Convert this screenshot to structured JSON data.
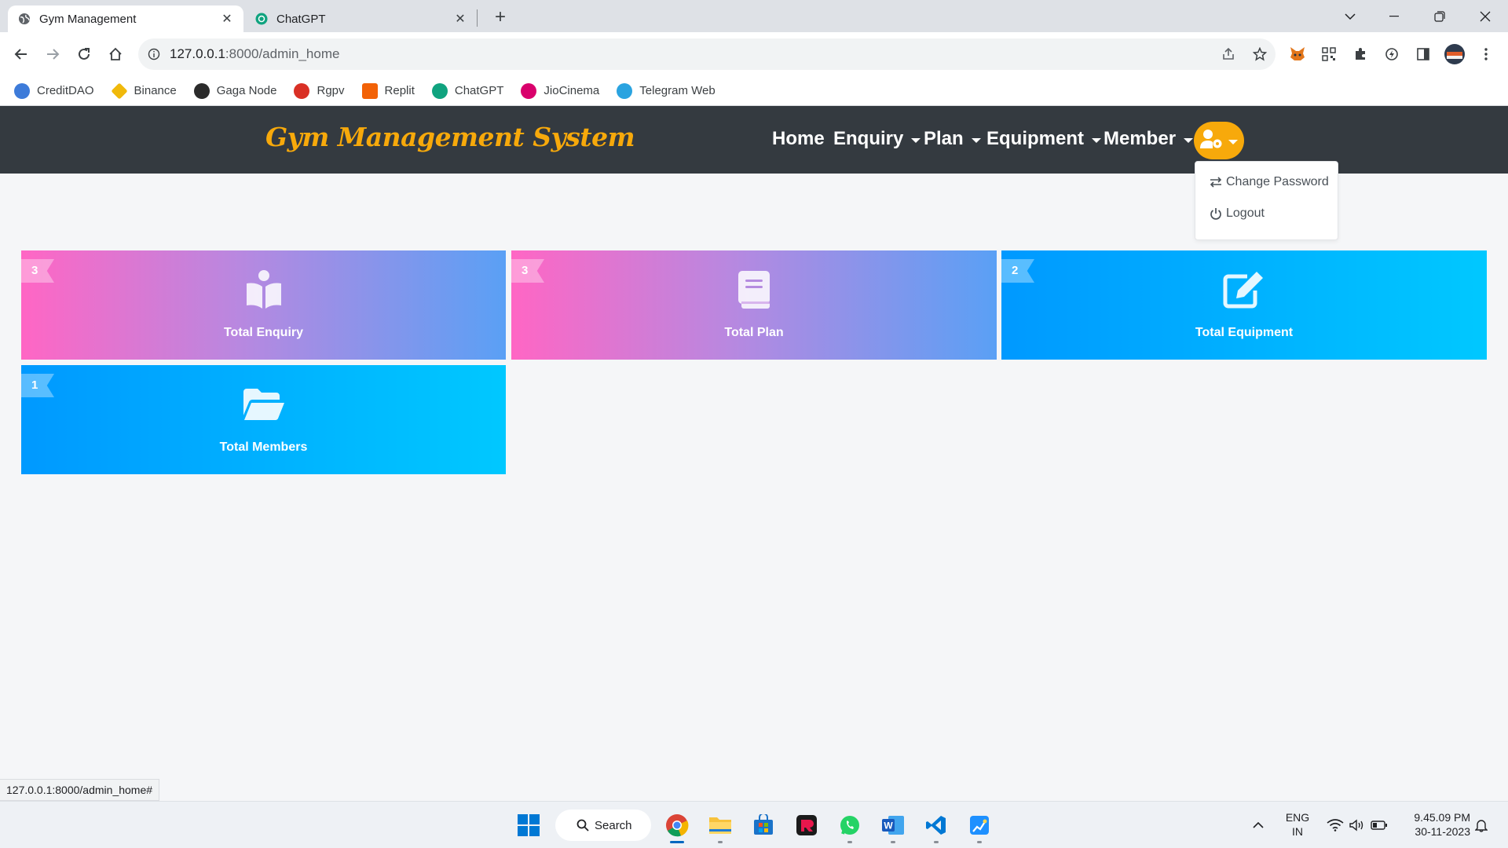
{
  "browser": {
    "tabs": [
      {
        "title": "Gym Management",
        "active": true,
        "icon": "globe-icon"
      },
      {
        "title": "ChatGPT",
        "active": false,
        "icon": "chatgpt-icon"
      }
    ],
    "url_host": "127.0.0.1",
    "url_path": ":8000/admin_home",
    "bookmarks": [
      {
        "label": "CreditDAO",
        "color": "#3d7bd9"
      },
      {
        "label": "Binance",
        "color": "#f0b90b"
      },
      {
        "label": "Gaga Node",
        "color": "#2b2b2b"
      },
      {
        "label": "Rgpv",
        "color": "#d93025"
      },
      {
        "label": "Replit",
        "color": "#f26207"
      },
      {
        "label": "ChatGPT",
        "color": "#10a37f"
      },
      {
        "label": "JioCinema",
        "color": "#d9006c"
      },
      {
        "label": "Telegram Web",
        "color": "#2aa3e0"
      }
    ],
    "status_url": "127.0.0.1:8000/admin_home#"
  },
  "app": {
    "brand": "Gym Management System",
    "brand_color": "#f7a90b",
    "nav": {
      "home": "Home",
      "enquiry": "Enquiry",
      "plan": "Plan",
      "equipment": "Equipment",
      "member": "Member"
    },
    "user_menu": {
      "change_password": "Change Password",
      "logout": "Logout"
    }
  },
  "cards": [
    {
      "count": "3",
      "label": "Total Enquiry",
      "icon": "book-reader-icon",
      "style": "pink"
    },
    {
      "count": "3",
      "label": "Total Plan",
      "icon": "book-icon",
      "style": "pink"
    },
    {
      "count": "2",
      "label": "Total Equipment",
      "icon": "edit-icon",
      "style": "blue"
    },
    {
      "count": "1",
      "label": "Total Members",
      "icon": "folder-open-icon",
      "style": "blue"
    }
  ],
  "taskbar": {
    "search_label": "Search",
    "lang_top": "ENG",
    "lang_bottom": "IN",
    "time": "9.45.09 PM",
    "date": "30-11-2023"
  }
}
